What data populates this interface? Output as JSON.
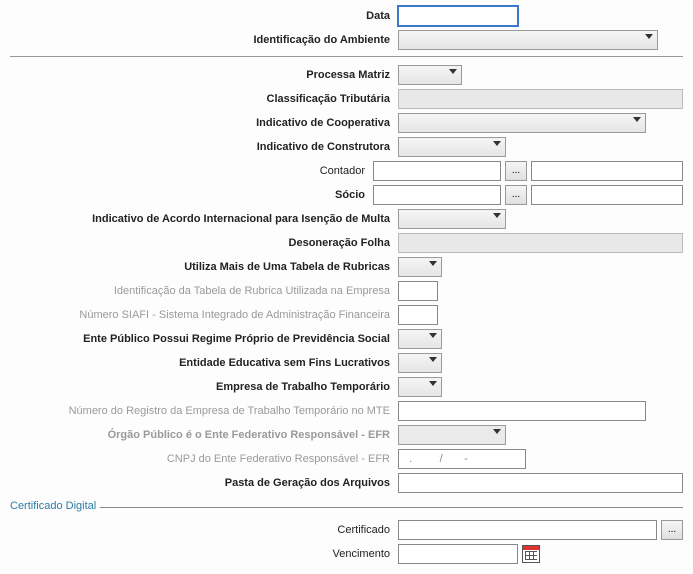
{
  "top": {
    "data_label": "Data",
    "data_value": "",
    "ambiente_label": "Identificação do Ambiente"
  },
  "main": {
    "processa_matriz": "Processa Matriz",
    "classificacao_tributaria": "Classificação Tributária",
    "ind_cooperativa": "Indicativo de Cooperativa",
    "ind_construtora": "Indicativo de Construtora",
    "contador": "Contador",
    "socio": "Sócio",
    "ind_acordo_multa": "Indicativo de Acordo Internacional para Isenção de Multa",
    "desoneracao_folha": "Desoneração Folha",
    "utiliza_rubricas": "Utiliza Mais de Uma Tabela de Rubricas",
    "id_tabela_rubrica": "Identificação da Tabela de Rubrica Utilizada na Empresa",
    "numero_siafi": "Número SIAFI - Sistema Integrado de Administração Financeira",
    "ente_publico_prev": "Ente Público Possui Regime Próprio de Previdência Social",
    "entidade_educativa": "Entidade Educativa sem Fins Lucrativos",
    "empresa_trab_temp": "Empresa de Trabalho Temporário",
    "num_registro_mte": "Número do Registro da Empresa de Trabalho Temporário no MTE",
    "orgao_efr": "Órgão Público é o Ente Federativo Responsável - EFR",
    "cnpj_efr_label": "CNPJ do Ente Federativo Responsável - EFR",
    "cnpj_efr_value": "  .         /       -",
    "pasta_arquivos": "Pasta de Geração dos Arquivos"
  },
  "cert": {
    "legend": "Certificado Digital",
    "certificado_label": "Certificado",
    "vencimento_label": "Vencimento"
  },
  "icons": {
    "ellipsis": "..."
  }
}
